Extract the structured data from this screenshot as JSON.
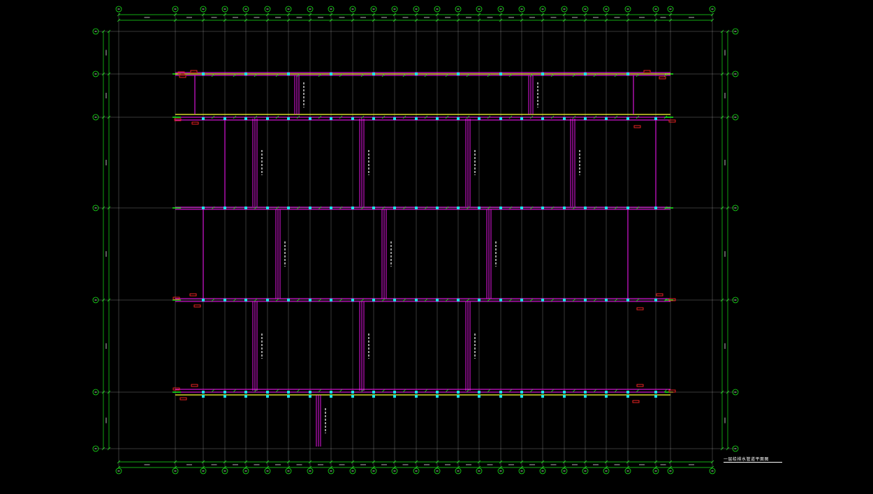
{
  "drawing": {
    "title": "一层给排水管道平面图",
    "colors": {
      "background": "#000000",
      "grid": "#19e619",
      "axis_line": "#cfcfcf",
      "pipe": "#ff19ff",
      "fixture": "#19e6e6",
      "highlight": "#ffff33",
      "tag": "#ff2626",
      "text": "#ffffff"
    },
    "column_axes": [
      "1",
      "2",
      "3",
      "4",
      "5",
      "6",
      "7",
      "8",
      "9",
      "10",
      "11",
      "12",
      "13",
      "14",
      "15",
      "16",
      "17",
      "18",
      "19",
      "20",
      "21",
      "22",
      "23",
      "24",
      "25",
      "26",
      "27",
      "28"
    ],
    "row_axes": [
      "F",
      "E",
      "D",
      "C",
      "B",
      "A"
    ]
  }
}
